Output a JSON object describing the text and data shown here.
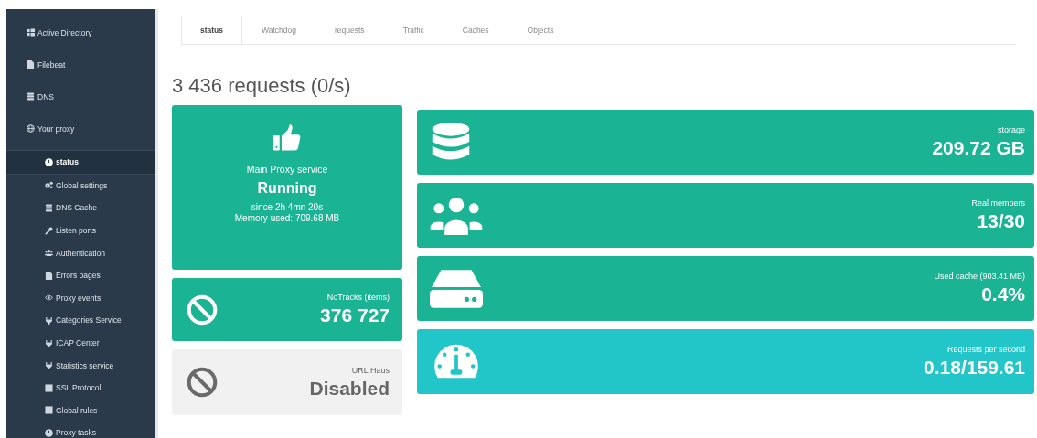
{
  "sidebar": {
    "items": [
      {
        "label": "Active Directory",
        "selected": false
      },
      {
        "label": "Filebeat",
        "selected": false
      },
      {
        "label": "DNS",
        "selected": false
      },
      {
        "label": "Your proxy",
        "selected": false,
        "children": [
          {
            "label": "status",
            "selected": true
          },
          {
            "label": "Global settings",
            "selected": false
          },
          {
            "label": "DNS Cache",
            "selected": false
          },
          {
            "label": "Listen ports",
            "selected": false
          },
          {
            "label": "Authentication",
            "selected": false
          },
          {
            "label": "Errors pages",
            "selected": false
          },
          {
            "label": "Proxy events",
            "selected": false
          },
          {
            "label": "Categories Service",
            "selected": false
          },
          {
            "label": "ICAP Center",
            "selected": false
          },
          {
            "label": "Statistics service",
            "selected": false
          },
          {
            "label": "SSL Protocol",
            "selected": false
          },
          {
            "label": "Global rules",
            "selected": false
          },
          {
            "label": "Proxy tasks",
            "selected": false
          }
        ]
      }
    ]
  },
  "tabs": [
    {
      "label": "status",
      "selected": true
    },
    {
      "label": "Watchdog",
      "selected": false
    },
    {
      "label": "requests",
      "selected": false
    },
    {
      "label": "Traffic",
      "selected": false
    },
    {
      "label": "Caches",
      "selected": false
    },
    {
      "label": "Objects",
      "selected": false
    }
  ],
  "heading": "3 436 requests (0/s)",
  "service": {
    "title": "Main Proxy service",
    "state": "Running",
    "since": "since 2h 4mn 20s",
    "memory": "Memory used: 709.68 MB"
  },
  "left_tiles": [
    {
      "color": "#1ab394",
      "label": "NoTracks (items)",
      "value": "376 727"
    },
    {
      "color": "#f1f1f2",
      "label": "URL Haus",
      "value": "Disabled"
    }
  ],
  "right_tiles": [
    {
      "color": "#1ab394",
      "label": "storage",
      "value": "209.72 GB"
    },
    {
      "color": "#1ab394",
      "label": "Real members",
      "value": "13/30"
    },
    {
      "color": "#1ab394",
      "label": "Used cache (903.41 MB)",
      "value": "0.4%"
    },
    {
      "color": "#23c6c8",
      "label": "Requests per second",
      "value": "0.18/159.61"
    }
  ]
}
